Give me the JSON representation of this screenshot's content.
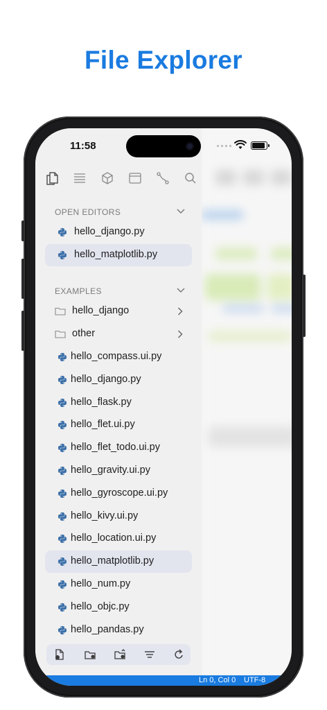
{
  "headline": "File Explorer",
  "status": {
    "time": "11:58"
  },
  "tabs": [
    {
      "icon": "files-icon"
    },
    {
      "icon": "outline-list-icon"
    },
    {
      "icon": "package-cube-icon"
    },
    {
      "icon": "window-icon"
    },
    {
      "icon": "git-branch-icon"
    },
    {
      "icon": "search-icon"
    }
  ],
  "open_editors": {
    "title": "OPEN EDITORS",
    "items": [
      {
        "label": "hello_django.py",
        "selected": false
      },
      {
        "label": "hello_matplotlib.py",
        "selected": true
      }
    ]
  },
  "examples": {
    "title": "EXAMPLES",
    "folders": [
      {
        "label": "hello_django"
      },
      {
        "label": "other"
      }
    ],
    "files": [
      {
        "label": "hello_compass.ui.py",
        "selected": false
      },
      {
        "label": "hello_django.py",
        "selected": false
      },
      {
        "label": "hello_flask.py",
        "selected": false
      },
      {
        "label": "hello_flet.ui.py",
        "selected": false
      },
      {
        "label": "hello_flet_todo.ui.py",
        "selected": false
      },
      {
        "label": "hello_gravity.ui.py",
        "selected": false
      },
      {
        "label": "hello_gyroscope.ui.py",
        "selected": false
      },
      {
        "label": "hello_kivy.ui.py",
        "selected": false
      },
      {
        "label": "hello_location.ui.py",
        "selected": false
      },
      {
        "label": "hello_matplotlib.py",
        "selected": true
      },
      {
        "label": "hello_num.py",
        "selected": false
      },
      {
        "label": "hello_objc.py",
        "selected": false
      },
      {
        "label": "hello_pandas.py",
        "selected": false
      }
    ]
  },
  "toolbar": [
    {
      "icon": "new-file-icon"
    },
    {
      "icon": "new-folder-icon"
    },
    {
      "icon": "open-folder-icon"
    },
    {
      "icon": "filter-icon"
    },
    {
      "icon": "refresh-icon"
    }
  ],
  "statusbar": {
    "position": "Ln 0, Col 0",
    "encoding": "UTF-8"
  },
  "colors": {
    "accent": "#1a7be0",
    "selection": "#e2e4ee",
    "sidebar": "#f0f0f0"
  }
}
